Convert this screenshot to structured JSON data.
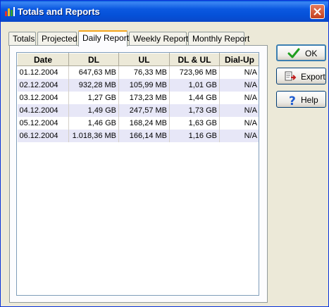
{
  "window": {
    "title": "Totals and Reports"
  },
  "tabs": [
    {
      "label": "Totals"
    },
    {
      "label": "Projected"
    },
    {
      "label": "Daily Report"
    },
    {
      "label": "Weekly Report"
    },
    {
      "label": "Monthly Report"
    }
  ],
  "active_tab": "Daily Report",
  "table": {
    "headers": [
      "Date",
      "DL",
      "UL",
      "DL & UL",
      "Dial-Up"
    ],
    "rows": [
      [
        "01.12.2004",
        "647,63 MB",
        "76,33 MB",
        "723,96 MB",
        "N/A"
      ],
      [
        "02.12.2004",
        "932,28 MB",
        "105,99 MB",
        "1,01 GB",
        "N/A"
      ],
      [
        "03.12.2004",
        "1,27 GB",
        "173,23 MB",
        "1,44 GB",
        "N/A"
      ],
      [
        "04.12.2004",
        "1,49 GB",
        "247,57 MB",
        "1,73 GB",
        "N/A"
      ],
      [
        "05.12.2004",
        "1,46 GB",
        "168,24 MB",
        "1,63 GB",
        "N/A"
      ],
      [
        "06.12.2004",
        "1.018,36 MB",
        "166,14 MB",
        "1,16 GB",
        "N/A"
      ]
    ]
  },
  "buttons": {
    "ok": {
      "label": "OK",
      "icon": "checkmark-icon"
    },
    "export": {
      "label": "Export",
      "icon": "export-icon"
    },
    "help": {
      "label": "Help",
      "icon": "question-icon"
    }
  },
  "colors": {
    "titlebar": "#0a5ddd",
    "row_alt": "#e7e7f7",
    "ok_check": "#1e9e1e",
    "help_q": "#1d5bd0"
  }
}
